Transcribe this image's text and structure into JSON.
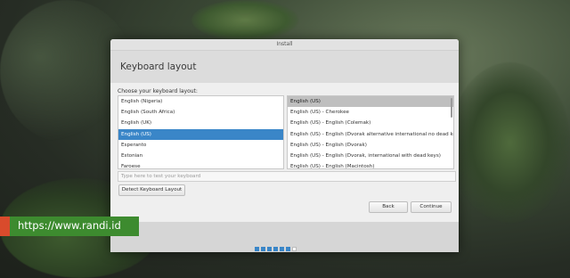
{
  "window": {
    "title": "Install"
  },
  "header": {
    "title": "Keyboard layout"
  },
  "prompt": "Choose your keyboard layout:",
  "layouts": [
    {
      "label": "English (Nigeria)",
      "selected": false
    },
    {
      "label": "English (South Africa)",
      "selected": false
    },
    {
      "label": "English (UK)",
      "selected": false
    },
    {
      "label": "English (US)",
      "selected": true
    },
    {
      "label": "Esperanto",
      "selected": false
    },
    {
      "label": "Estonian",
      "selected": false
    },
    {
      "label": "Faroese",
      "selected": false
    }
  ],
  "variants": [
    {
      "label": "English (US)",
      "selected": true
    },
    {
      "label": "English (US) - Cherokee",
      "selected": false
    },
    {
      "label": "English (US) - English (Colemak)",
      "selected": false
    },
    {
      "label": "English (US) - English (Dvorak alternative international no dead keys)",
      "selected": false
    },
    {
      "label": "English (US) - English (Dvorak)",
      "selected": false
    },
    {
      "label": "English (US) - English (Dvorak, international with dead keys)",
      "selected": false
    },
    {
      "label": "English (US) - English (Macintosh)",
      "selected": false
    }
  ],
  "test_input": {
    "placeholder": "Type here to test your keyboard"
  },
  "buttons": {
    "detect": "Detect Keyboard Layout",
    "back": "Back",
    "continue": "Continue"
  },
  "progress": {
    "total_steps": 7,
    "completed": 6
  },
  "watermark": "https://www.randi.id",
  "colors": {
    "accent": "#3a86c8",
    "watermark_bg": "#3d8b2f",
    "watermark_accent": "#d94b2c"
  }
}
